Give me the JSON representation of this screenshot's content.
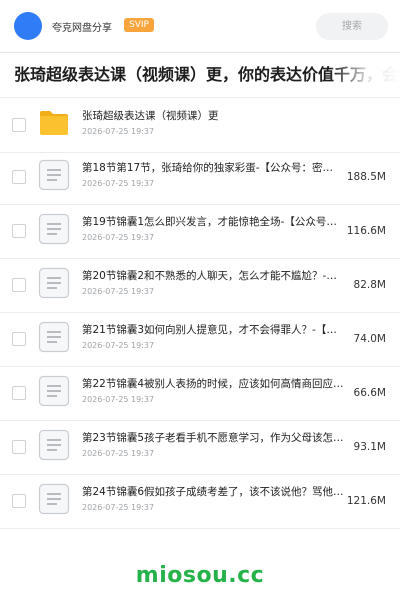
{
  "header": {
    "app_name": "夸克网盘分享",
    "badge": "SVIP",
    "search_placeholder": "搜索"
  },
  "page_title": "张琦超级表达课（视频课）更，你的表达价值千万，会说话",
  "items": [
    {
      "type": "folder",
      "name": "张琦超级表达课（视频课）更",
      "date": "2026-07-25 19:37",
      "size": ""
    },
    {
      "type": "file",
      "name": "第18节第17节，张琦给你的独家彩蛋-【公众号：密…",
      "date": "2026-07-25 19:37",
      "size": "188.5M"
    },
    {
      "type": "file",
      "name": "第19节锦囊1怎么即兴发言，才能惊艳全场-【公众号…",
      "date": "2026-07-25 19:37",
      "size": "116.6M"
    },
    {
      "type": "file",
      "name": "第20节锦囊2和不熟悉的人聊天，怎么才能不尴尬？-…",
      "date": "2026-07-25 19:37",
      "size": "82.8M"
    },
    {
      "type": "file",
      "name": "第21节锦囊3如何向别人提意见，才不会得罪人？-【…",
      "date": "2026-07-25 19:37",
      "size": "74.0M"
    },
    {
      "type": "file",
      "name": "第22节锦囊4被别人表扬的时候，应该如何高情商回应…",
      "date": "2026-07-25 19:37",
      "size": "66.6M"
    },
    {
      "type": "file",
      "name": "第23节锦囊5孩子老看手机不愿意学习，作为父母该怎…",
      "date": "2026-07-25 19:37",
      "size": "93.1M"
    },
    {
      "type": "file",
      "name": "第24节锦囊6假如孩子成绩考差了，该不该说他？骂他…",
      "date": "2026-07-25 19:37",
      "size": "121.6M"
    }
  ],
  "watermark": "miosou.cc",
  "colors": {
    "accent": "#2f7cf6",
    "badge": "#f7a43b",
    "folder": "#f9c22e",
    "watermark": "#26b24a"
  }
}
